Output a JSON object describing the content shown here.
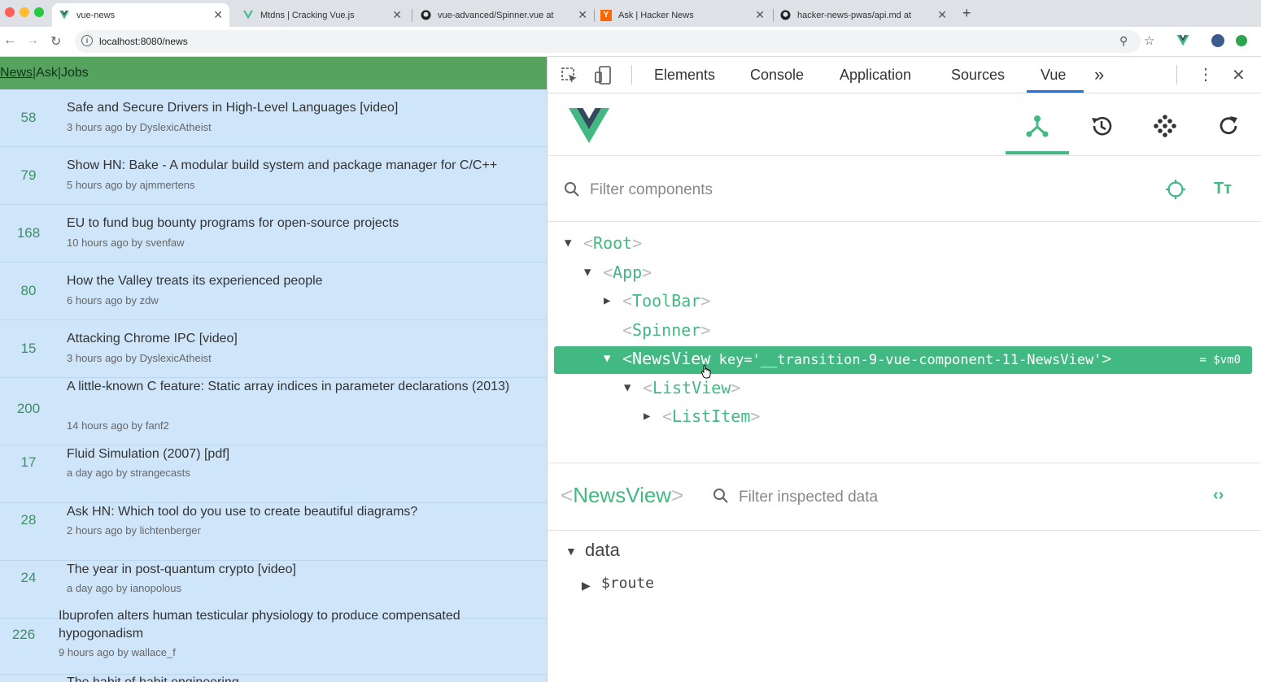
{
  "browser": {
    "tabs": [
      {
        "title": "vue-news",
        "favicon": "vue-icon",
        "active": true
      },
      {
        "title": "Mtdns | Cracking Vue.js",
        "favicon": "vue-icon",
        "active": false
      },
      {
        "title": "vue-advanced/Spinner.vue at",
        "favicon": "github-icon",
        "active": false
      },
      {
        "title": "Ask | Hacker News",
        "favicon": "hn-icon",
        "active": false
      },
      {
        "title": "hacker-news-pwas/api.md at",
        "favicon": "github-icon",
        "active": false
      }
    ],
    "url": "localhost:8080/news"
  },
  "app": {
    "nav": {
      "news": "News",
      "sep1": "|",
      "ask": "Ask",
      "sep2": "|",
      "jobs": "Jobs"
    },
    "items": [
      {
        "points": "58",
        "title": "Safe and Secure Drivers in High-Level Languages [video]",
        "meta": "3 hours ago by DyslexicAtheist"
      },
      {
        "points": "79",
        "title": "Show HN: Bake - A modular build system and package manager for C/C++",
        "meta": "5 hours ago by ajmmertens"
      },
      {
        "points": "168",
        "title": "EU to fund bug bounty programs for open-source projects",
        "meta": "10 hours ago by svenfaw"
      },
      {
        "points": "80",
        "title": "How the Valley treats its experienced people",
        "meta": "6 hours ago by zdw"
      },
      {
        "points": "15",
        "title": "Attacking Chrome IPC [video]",
        "meta": "3 hours ago by DyslexicAtheist"
      },
      {
        "points": "200",
        "title": "A little-known C feature: Static array indices in parameter declarations (2013)",
        "meta": "14 hours ago by fanf2"
      },
      {
        "points": "17",
        "title": "Fluid Simulation (2007) [pdf]",
        "meta": "a day ago by strangecasts"
      },
      {
        "points": "28",
        "title": "Ask HN: Which tool do you use to create beautiful diagrams?",
        "meta": "2 hours ago by lichtenberger"
      },
      {
        "points": "24",
        "title": "The year in post-quantum crypto [video]",
        "meta": "a day ago by ianopolous"
      },
      {
        "points": "226",
        "title": "Ibuprofen alters human testicular physiology to produce compensated hypogonadism",
        "meta": "9 hours ago by wallace_f"
      },
      {
        "points": "",
        "title": "The habit of habit engineering",
        "meta": ""
      }
    ]
  },
  "devtools": {
    "tabs": [
      "Elements",
      "Console",
      "Application",
      "Sources",
      "Vue"
    ],
    "active_tab": "Vue",
    "more": "»",
    "filter_placeholder": "Filter components",
    "tree": [
      {
        "name": "Root",
        "arrow": "▼"
      },
      {
        "name": "App",
        "arrow": "▼"
      },
      {
        "name": "ToolBar",
        "arrow": "▶"
      },
      {
        "name": "Spinner",
        "arrow": ""
      },
      {
        "name": "NewsView",
        "arrow": "▼",
        "key": " key='__transition-9-vue-component-11-NewsView'",
        "vm": "= $vm0",
        "selected": true
      },
      {
        "name": "ListView",
        "arrow": "▼"
      },
      {
        "name": "ListItem",
        "arrow": "▶"
      }
    ],
    "inspector": {
      "component": "NewsView",
      "filter_placeholder": "Filter inspected data",
      "section": "data",
      "field": "$route"
    }
  },
  "colors": {
    "vue_green": "#42b983",
    "app_nav": "#55a35f",
    "app_bg": "#cfe5fa"
  }
}
